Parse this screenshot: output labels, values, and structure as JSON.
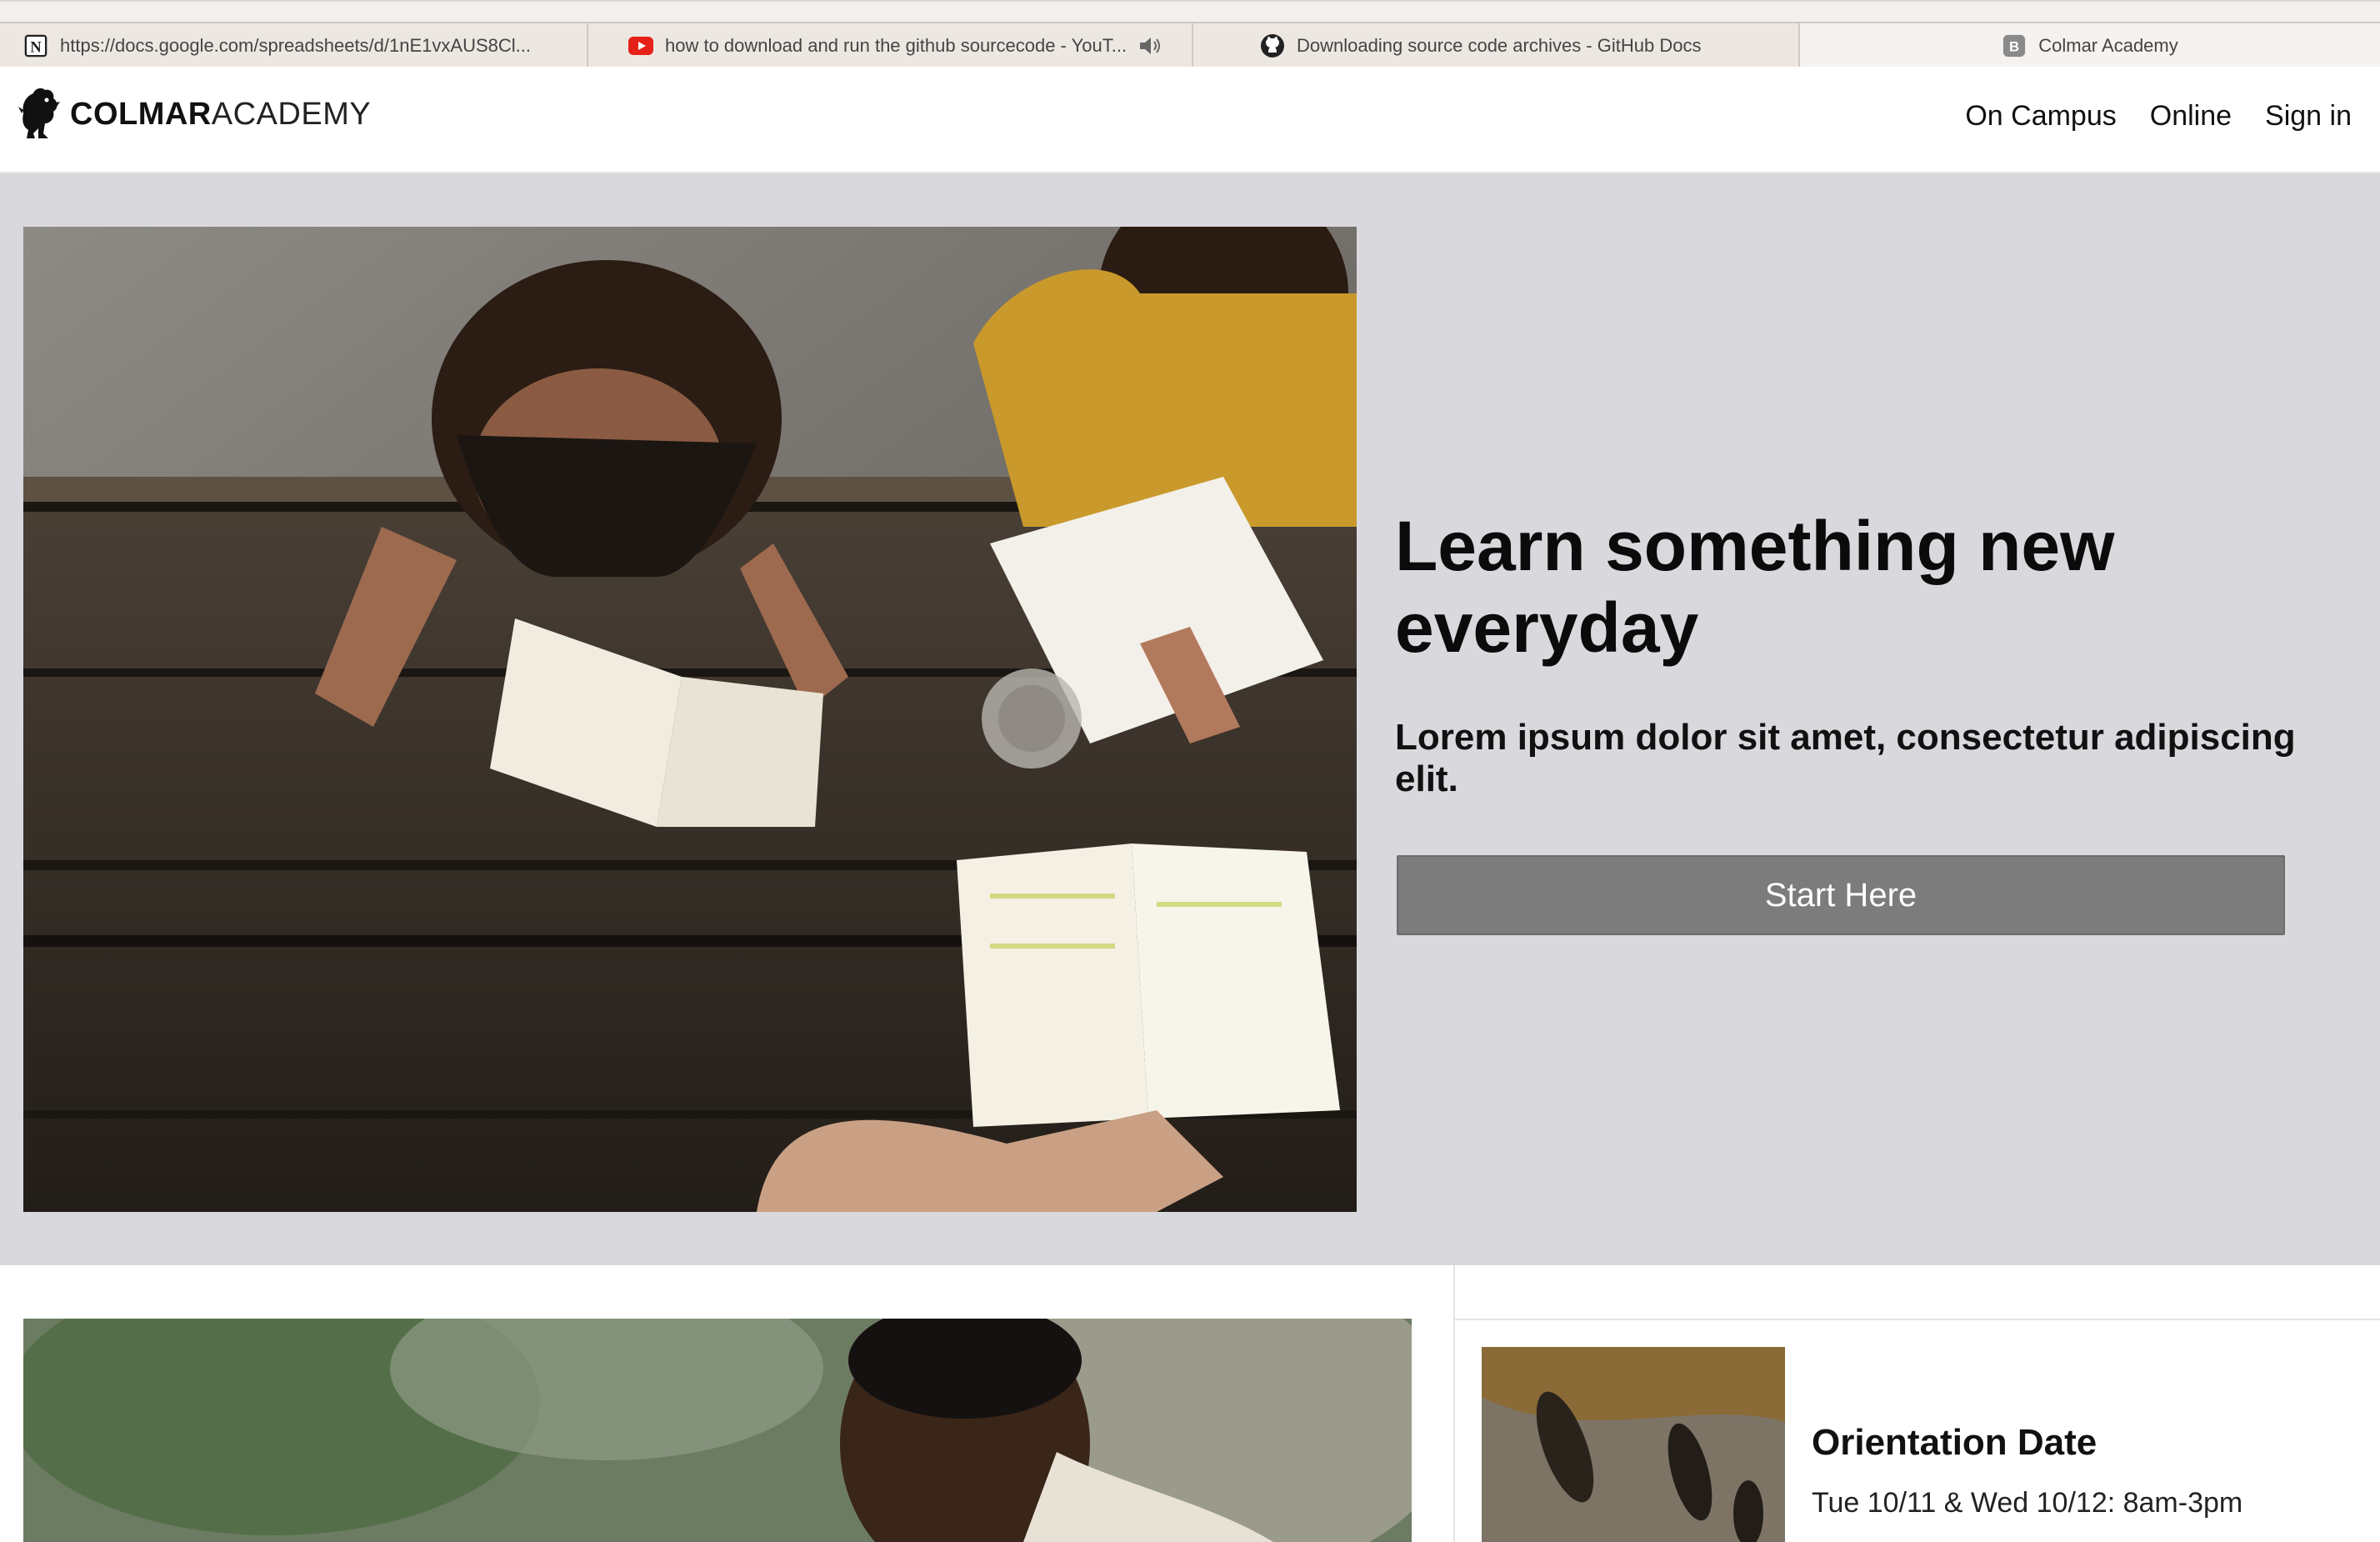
{
  "browser": {
    "tabs": [
      {
        "label": "https://docs.google.com/spreadsheets/d/1nE1vxAUS8Cl...",
        "icon": "notion-icon"
      },
      {
        "label": "how to download and run the github sourcecode - YouT...",
        "icon": "youtube-icon",
        "audio_icon": "speaker-icon"
      },
      {
        "label": "Downloading source code archives - GitHub Docs",
        "icon": "github-icon"
      },
      {
        "label": "Colmar Academy",
        "icon": "b-favicon-icon",
        "active": true
      }
    ]
  },
  "header": {
    "logo_bold": "COLMAR",
    "logo_light": "ACADEMY",
    "logo_icon": "lion-icon",
    "nav": [
      "On Campus",
      "Online",
      "Sign in"
    ]
  },
  "hero": {
    "title": "Learn something new everyday",
    "subtitle": "Lorem ipsum dolor sit amet, consectetur adipiscing elit.",
    "cta_label": "Start Here",
    "background_color": "#d9d8dd",
    "button_color": "#7c7c7c"
  },
  "event": {
    "title": "Orientation Date",
    "date": "Tue 10/11 & Wed 10/12: 8am-3pm"
  }
}
